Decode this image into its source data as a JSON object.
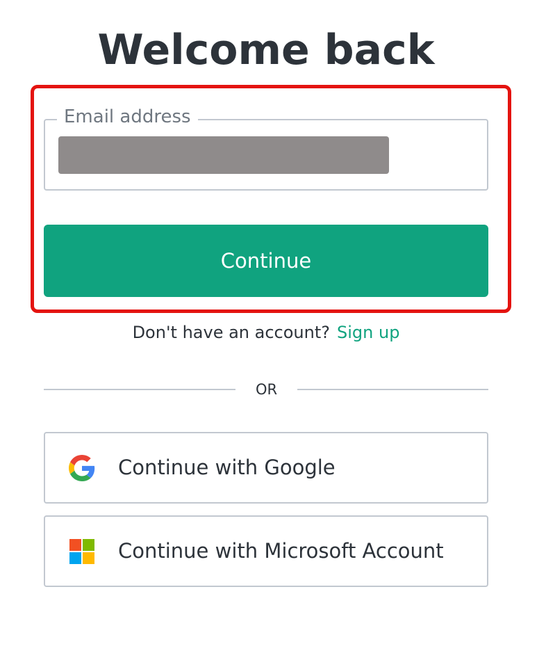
{
  "page": {
    "title": "Welcome back"
  },
  "form": {
    "email_label": "Email address",
    "email_value": "",
    "continue_label": "Continue"
  },
  "signup": {
    "prompt": "Don't have an account?",
    "link_label": "Sign up"
  },
  "divider": {
    "label": "OR"
  },
  "social": {
    "google_label": "Continue with Google",
    "microsoft_label": "Continue with Microsoft Account"
  },
  "colors": {
    "accent": "#10a37f",
    "highlight": "#e4130f",
    "border": "#c2c8d0",
    "text": "#2d333a",
    "redacted": "#8f8b8b"
  },
  "icons": {
    "google": "google-logo-icon",
    "microsoft": "microsoft-logo-icon"
  }
}
